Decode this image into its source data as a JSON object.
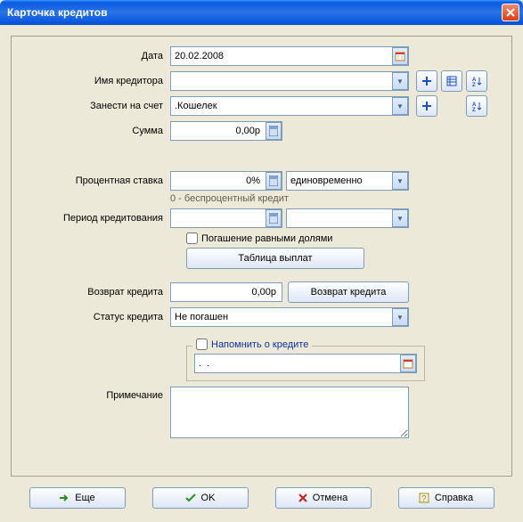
{
  "window": {
    "title": "Карточка кредитов"
  },
  "fields": {
    "date": {
      "label": "Дата",
      "value": "20.02.2008"
    },
    "creditor": {
      "label": "Имя кредитора",
      "value": ""
    },
    "account": {
      "label": "Занести на счет",
      "value": ".Кошелек"
    },
    "sum": {
      "label": "Сумма",
      "value": "0,00р"
    },
    "rate": {
      "label": "Процентная ставка",
      "value": "0%",
      "mode": "единовременно",
      "hint": "0 - беспроцентный кредит"
    },
    "period": {
      "label": "Период кредитования",
      "value": "",
      "unit": ""
    },
    "equalPay": {
      "label": "Погашение равными долями",
      "checked": false
    },
    "scheduleBtn": "Таблица выплат",
    "returnAmt": {
      "label": "Возврат кредита",
      "value": "0,00р",
      "button": "Возврат кредита"
    },
    "status": {
      "label": "Статус кредита",
      "value": "Не погашен"
    },
    "remind": {
      "label": "Напомнить о кредите",
      "checked": false,
      "date": ".  ."
    },
    "note": {
      "label": "Примечание",
      "value": ""
    }
  },
  "buttons": {
    "more": "Еще",
    "ok": "OK",
    "cancel": "Отмена",
    "help": "Справка"
  }
}
